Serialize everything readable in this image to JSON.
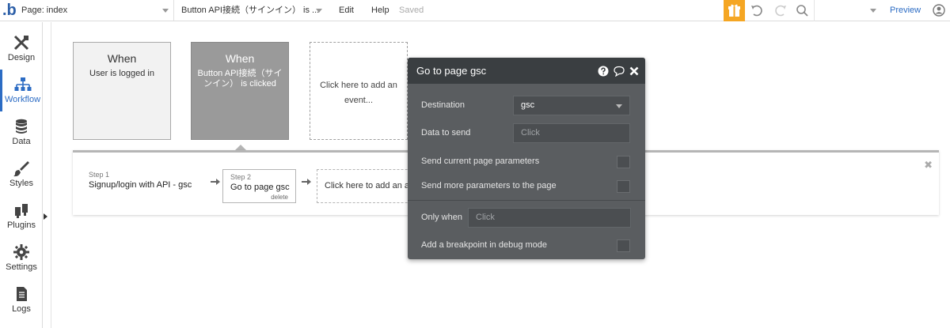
{
  "topbar": {
    "logo": ".b",
    "page_label": "Page: index",
    "element_label": "Button API接続（サインイン） is ...",
    "edit": "Edit",
    "help": "Help",
    "saved": "Saved",
    "preview": "Preview",
    "accent_color": "#f5a623"
  },
  "sidebar": {
    "items": [
      {
        "label": "Design",
        "icon": "design-icon"
      },
      {
        "label": "Workflow",
        "icon": "workflow-icon",
        "active": true
      },
      {
        "label": "Data",
        "icon": "database-icon"
      },
      {
        "label": "Styles",
        "icon": "brush-icon"
      },
      {
        "label": "Plugins",
        "icon": "plug-icon"
      },
      {
        "label": "Settings",
        "icon": "gear-icon"
      },
      {
        "label": "Logs",
        "icon": "document-icon"
      }
    ]
  },
  "events": [
    {
      "when": "When",
      "desc": "User is logged in"
    },
    {
      "when": "When",
      "desc": "Button API接続（サインイン） is clicked",
      "selected": true
    },
    {
      "desc": "Click here to add an event..."
    }
  ],
  "steps": {
    "step1": {
      "num": "Step 1",
      "title": "Signup/login with API - gsc"
    },
    "step2": {
      "num": "Step 2",
      "title": "Go to page gsc",
      "delete": "delete"
    },
    "add": "Click here to add an action..."
  },
  "panel": {
    "title": "Go to page gsc",
    "destination_label": "Destination",
    "destination_value": "gsc",
    "data_label": "Data to send",
    "data_placeholder": "Click",
    "send_current_label": "Send current page parameters",
    "send_more_label": "Send more parameters to the page",
    "only_when_label": "Only when",
    "only_when_placeholder": "Click",
    "breakpoint_label": "Add a breakpoint in debug mode"
  }
}
